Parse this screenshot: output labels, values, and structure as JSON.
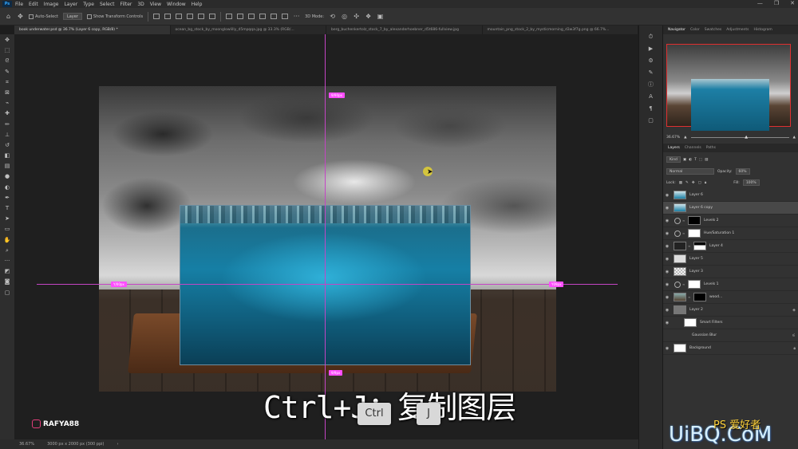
{
  "app": {
    "logo": "Ps"
  },
  "menu": [
    "File",
    "Edit",
    "Image",
    "Layer",
    "Type",
    "Select",
    "Filter",
    "3D",
    "View",
    "Window",
    "Help"
  ],
  "window_buttons": [
    "—",
    "❐",
    "✕"
  ],
  "options": {
    "auto_select": "Auto-Select",
    "auto_select_target": "Layer",
    "show_transform": "Show Transform Controls",
    "mode_3d": "3D Mode:"
  },
  "tabs": [
    "book underwater.psd @ 36.7% (Layer 6 copy, RGB/8) *",
    "ocean_bg_stock_by_moonglowlilly_d5mpqqa.jpg @ 33.3% (RGB/...",
    "berg_buchenkertolz_stock_7_by_alexanderhoebner_d5t686-fullview.jpg",
    "mountain_png_stock_2_by_mysticmorning_d3w3f7g.png @ 66.7%..."
  ],
  "measure_labels": {
    "top": "9/90px",
    "left": "Y/00px",
    "right": "Y09px",
    "bottom": "9/9px"
  },
  "subtitle": "Ctrl+J：复制图层",
  "keys": {
    "ctrl": "Ctrl",
    "j": "J"
  },
  "watermark": "RAFYA88",
  "status": {
    "zoom": "36.67%",
    "doc": "3000 px x 2000 px (300 ppi)"
  },
  "panel": {
    "top_tabs": [
      "Navigator",
      "Color",
      "Swatches",
      "Adjustments",
      "Histogram"
    ],
    "nav_zoom": "36.67%",
    "layers_tabs": [
      "Layers",
      "Channels",
      "Paths"
    ],
    "filter_kind": "Kind",
    "blend_mode": "Normal",
    "opacity_label": "Opacity:",
    "opacity_value": "60%",
    "lock_label": "Lock:",
    "fill_label": "Fill:",
    "fill_value": "100%"
  },
  "layers": [
    {
      "name": "Layer 6",
      "thumb": "water"
    },
    {
      "name": "Layer 6 copy",
      "thumb": "water",
      "selected": true
    },
    {
      "name": "Levels 2",
      "adj": true,
      "mask": "black"
    },
    {
      "name": "Hue/Saturation 1",
      "adj": true,
      "mask": "white"
    },
    {
      "name": "Layer 4",
      "thumb": "dark",
      "mask": "mountain"
    },
    {
      "name": "Layer 5",
      "thumb": "light"
    },
    {
      "name": "Layer 3",
      "thumb": "check"
    },
    {
      "name": "Levels 1",
      "adj": true,
      "mask": "white"
    },
    {
      "name": "wood...",
      "thumb": "wood",
      "mask": "black"
    },
    {
      "name": "Layer 2",
      "thumb": "gray",
      "smart": true
    },
    {
      "name": "Smart Filters",
      "sub": true,
      "mask": "white"
    },
    {
      "name": "Gaussian Blur",
      "sub2": true
    },
    {
      "name": "Background",
      "thumb": "white",
      "locked": true
    }
  ],
  "brand": {
    "text": "UiBQ.CoM",
    "ps": "PS 爱好者"
  },
  "colors": {
    "guide": "#c445c4",
    "label": "#ff4dff",
    "selection": "#e03030"
  }
}
